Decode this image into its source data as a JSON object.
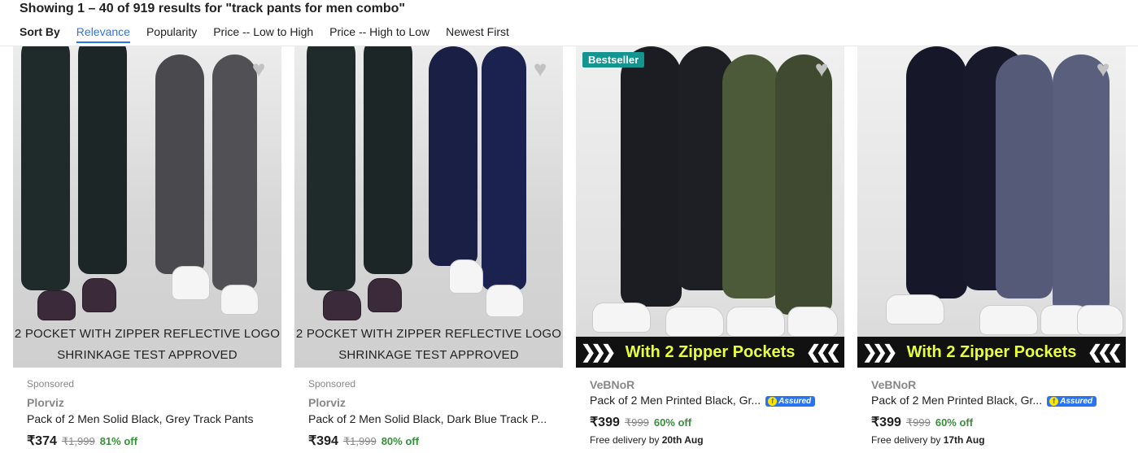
{
  "header": {
    "results_text": "Showing 1 – 40 of 919 results for \"track pants for men combo\"",
    "sort_label": "Sort By",
    "sort_options": [
      "Relevance",
      "Popularity",
      "Price -- Low to High",
      "Price -- High to Low",
      "Newest First"
    ],
    "active_sort": "Relevance"
  },
  "products": [
    {
      "image_text_1": "2 POCKET WITH ZIPPER   REFLECTIVE LOGO",
      "image_text_2": "SHRINKAGE TEST APPROVED",
      "sponsored": "Sponsored",
      "brand": "Plorviz",
      "title": "Pack of 2 Men Solid Black, Grey Track Pants",
      "price": "₹374",
      "mrp": "₹1,999",
      "discount": "81% off"
    },
    {
      "image_text_1": "2 POCKET WITH ZIPPER   REFLECTIVE LOGO",
      "image_text_2": "SHRINKAGE TEST APPROVED",
      "sponsored": "Sponsored",
      "brand": "Plorviz",
      "title": "Pack of 2 Men Solid Black, Dark Blue Track P...",
      "price": "₹394",
      "mrp": "₹1,999",
      "discount": "80% off"
    },
    {
      "badge": "Bestseller",
      "banner": "With 2 Zipper Pockets",
      "brand": "VeBNoR",
      "title": "Pack of 2 Men Printed Black, Gr...",
      "assured": "Assured",
      "price": "₹399",
      "mrp": "₹999",
      "discount": "60% off",
      "delivery_prefix": "Free delivery by ",
      "delivery_date": "20th Aug"
    },
    {
      "banner": "With 2 Zipper Pockets",
      "brand": "VeBNoR",
      "title": "Pack of 2 Men Printed Black, Gr...",
      "assured": "Assured",
      "price": "₹399",
      "mrp": "₹999",
      "discount": "60% off",
      "delivery_prefix": "Free delivery by ",
      "delivery_date": "17th Aug"
    }
  ],
  "colors": {
    "accent": "#2874f0",
    "discount": "#388e3c",
    "badge": "#14958f",
    "banner_text": "#e8ff3a"
  },
  "icons": {
    "wishlist": "heart-icon",
    "assured": "flipkart-assured-icon"
  }
}
